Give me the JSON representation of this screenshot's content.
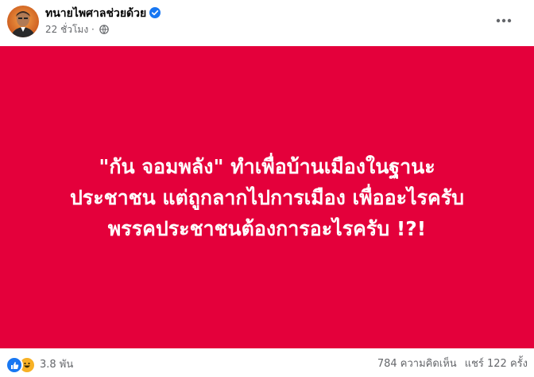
{
  "post": {
    "author": "ทนายไพศาลช่วยด้วย",
    "time": "22 ชั่วโมง",
    "separator": "·",
    "body_lines": [
      "\"กัน จอมพลัง\" ทำเพื่อบ้านเมืองในฐานะ",
      "ประชาชน แต่ถูกลากไปการเมือง เพื่ออะไรครับ",
      "พรรคประชาชนต้องการอะไรครับ !?!"
    ],
    "background_color": "#e4003b"
  },
  "footer": {
    "reaction_count": "3.8 พัน",
    "comments": "784 ความคิดเห็น",
    "shares": "แชร์ 122 ครั้ง"
  },
  "icons": {
    "verified": "verified-badge-icon",
    "audience": "globe-icon",
    "more": "more-options-icon",
    "reactions": [
      "like-icon",
      "haha-icon"
    ]
  }
}
